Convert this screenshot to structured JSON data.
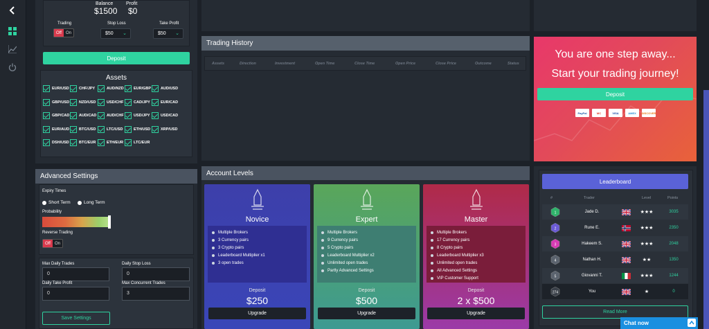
{
  "nav": {
    "back_icon": "chevron-left-icon",
    "items": [
      "dashboard-icon",
      "chart-icon",
      "power-icon"
    ]
  },
  "account": {
    "balance_label": "Balance",
    "balance_value": "$1500",
    "profit_label": "Profit",
    "profit_value": "$0",
    "trading_label": "Trading",
    "stoploss_label": "Stop Loss",
    "takeprofit_label": "Take Profit",
    "toggle_off": "Off",
    "toggle_on": "On",
    "stoploss_value": "$50",
    "takeprofit_value": "$50",
    "deposit_label": "Deposit"
  },
  "assets": {
    "title": "Assets",
    "items": [
      "EUR/USD",
      "CHF/JPY",
      "AUD/NZD",
      "EUR/GBP",
      "AUD/USD",
      "GBP/USD",
      "NZD/USD",
      "USD/CHF",
      "CAD/JPY",
      "EUR/CAD",
      "GBP/CAD",
      "AUD/CAD",
      "AUD/CHF",
      "USD/JPY",
      "USD/CAD",
      "EUR/AUD",
      "BTC/USD",
      "LTC/USD",
      "ETH/USD",
      "XRP/USD",
      "DSH/USD",
      "BTC/EUR",
      "ETH/EUR",
      "LTC/EUR"
    ]
  },
  "advanced": {
    "title": "Advanced Settings",
    "expiry_label": "Expiry Times",
    "short_term": "Short Term",
    "long_term": "Long Term",
    "probability_label": "Probability",
    "reverse_label": "Reverse Trading",
    "max_daily_trades_label": "Max Daily Trades",
    "max_daily_trades_value": "0",
    "daily_stop_loss_label": "Daily Stop Loss",
    "daily_stop_loss_value": "0",
    "daily_take_profit_label": "Daily Take Profit",
    "daily_take_profit_value": "0",
    "max_concurrent_label": "Max Concurrent Trades",
    "max_concurrent_value": "3",
    "save_label": "Save Settings"
  },
  "history": {
    "title": "Trading History",
    "columns": [
      "Assets",
      "Direction",
      "Investment",
      "Open Time",
      "Close Time",
      "Open Price",
      "Close Price",
      "Outcome",
      "Status"
    ]
  },
  "levels": {
    "title": "Account Levels",
    "deposit_label": "Deposit",
    "upgrade_label": "Upgrade",
    "cards": [
      {
        "name": "Novice",
        "amount": "$250",
        "features": [
          "Multiple Brokers",
          "3 Currency pairs",
          "3 Crypto pairs",
          "Leaderboard Multiplier x1",
          "3 open trades"
        ]
      },
      {
        "name": "Expert",
        "amount": "$500",
        "features": [
          "Multiple Brokers",
          "9 Currency pairs",
          "5 Crypto pairs",
          "Leaderboard Multiplier x2",
          "Unlimited open trades",
          "Partly Advanced Settings"
        ]
      },
      {
        "name": "Master",
        "amount": "2 x $500",
        "features": [
          "Multiple Brokers",
          "17 Currency pairs",
          "8 Crypto pairs",
          "Leaderboard Multiplier x3",
          "Unlimited open trades",
          "All Advanced Settings",
          "VIP Customer Support"
        ]
      }
    ]
  },
  "promo": {
    "line1": "You are one step away...",
    "line2": "Start your trading journey!",
    "deposit_label": "Deposit",
    "cards": [
      "PayPal",
      "MC",
      "VISA",
      "AMEX",
      "DISCOVER"
    ]
  },
  "leaderboard": {
    "title": "Leaderboard",
    "columns": [
      "#",
      "Trader",
      "Level",
      "Points"
    ],
    "rows": [
      {
        "rank": "1",
        "name": "Jade D.",
        "stars": "★★★",
        "points": "3035",
        "color": "#2fb36b",
        "flag": "uk"
      },
      {
        "rank": "2",
        "name": "Rune E.",
        "stars": "★★★",
        "points": "2350",
        "color": "#6b5bd6",
        "flag": "no"
      },
      {
        "rank": "3",
        "name": "Hakeem S.",
        "stars": "★★★",
        "points": "2048",
        "color": "#d63bb4",
        "flag": "uk"
      },
      {
        "rank": "4",
        "name": "Nathan H.",
        "stars": "★★",
        "points": "1350",
        "color": "#5b636e",
        "flag": "uk"
      },
      {
        "rank": "5",
        "name": "Giovanni T.",
        "stars": "★★★",
        "points": "1244",
        "color": "#5b636e",
        "flag": "it"
      },
      {
        "rank": "274",
        "name": "You",
        "stars": "★",
        "points": "0",
        "color": "#3a4049",
        "flag": "uk"
      }
    ],
    "read_more": "Read More"
  },
  "chat": {
    "label": "Chat now"
  },
  "colors": {
    "accent": "#2fd3a0",
    "off": "#d93a4d",
    "leaderboard": "#5a62d8"
  }
}
